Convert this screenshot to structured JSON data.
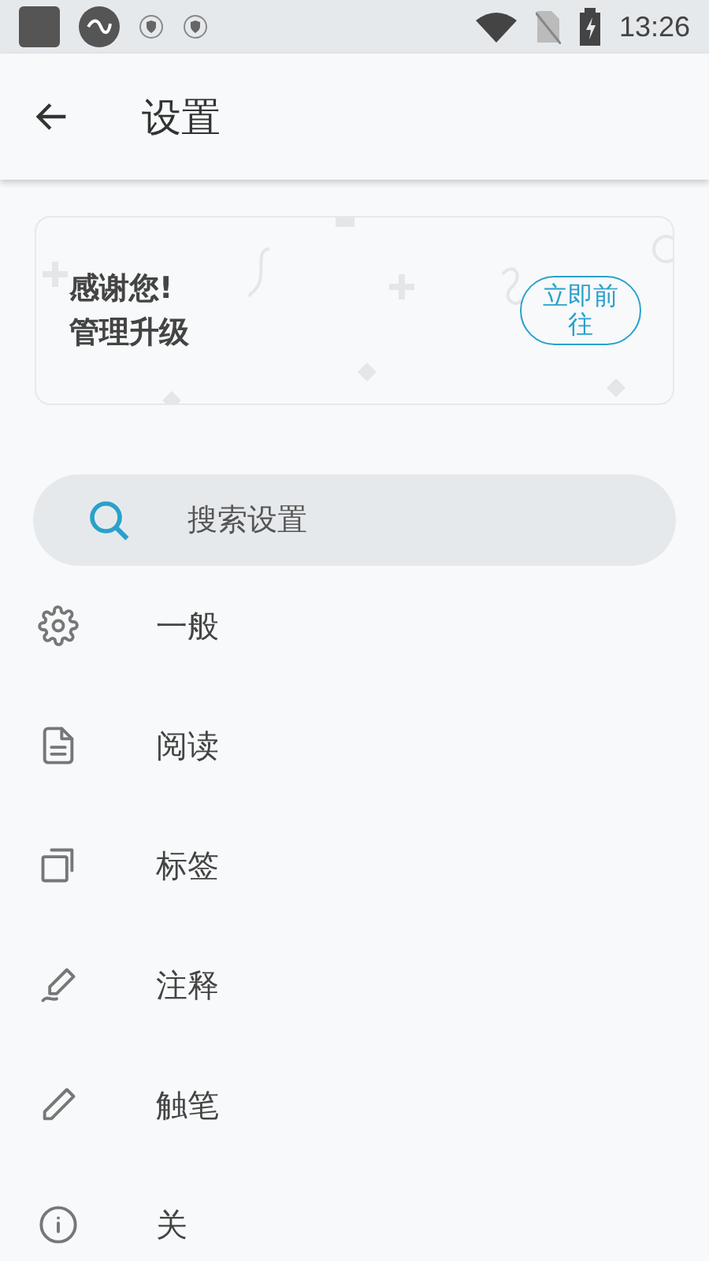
{
  "status_bar": {
    "time": "13:26"
  },
  "app_bar": {
    "title": "设置"
  },
  "promo": {
    "lines": [
      "感谢您!",
      "管理升级"
    ],
    "button": "立即前往"
  },
  "search": {
    "placeholder": "搜索设置"
  },
  "items": [
    {
      "kind": "gear",
      "label": "一般"
    },
    {
      "kind": "document",
      "label": "阅读"
    },
    {
      "kind": "copy",
      "label": "标签"
    },
    {
      "kind": "signature",
      "label": "注释"
    },
    {
      "kind": "pencil",
      "label": "触笔"
    },
    {
      "kind": "info",
      "label": "关"
    }
  ]
}
